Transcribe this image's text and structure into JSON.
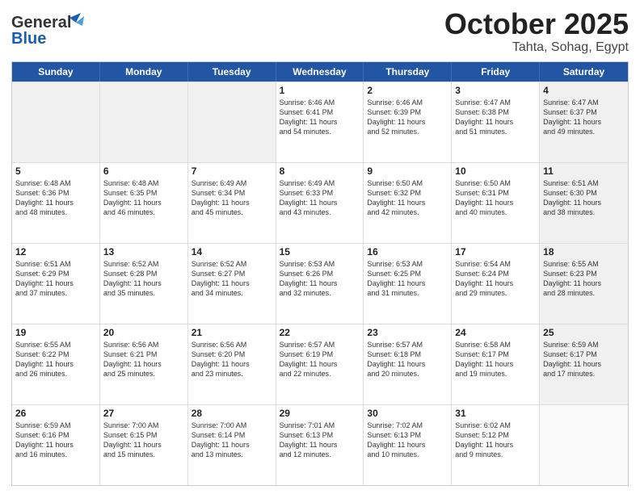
{
  "logo": {
    "line1": "General",
    "line2": "Blue"
  },
  "title": "October 2025",
  "location": "Tahta, Sohag, Egypt",
  "days_of_week": [
    "Sunday",
    "Monday",
    "Tuesday",
    "Wednesday",
    "Thursday",
    "Friday",
    "Saturday"
  ],
  "weeks": [
    [
      {
        "day": "",
        "info": ""
      },
      {
        "day": "",
        "info": ""
      },
      {
        "day": "",
        "info": ""
      },
      {
        "day": "1",
        "info": "Sunrise: 6:46 AM\nSunset: 6:41 PM\nDaylight: 11 hours\nand 54 minutes."
      },
      {
        "day": "2",
        "info": "Sunrise: 6:46 AM\nSunset: 6:39 PM\nDaylight: 11 hours\nand 52 minutes."
      },
      {
        "day": "3",
        "info": "Sunrise: 6:47 AM\nSunset: 6:38 PM\nDaylight: 11 hours\nand 51 minutes."
      },
      {
        "day": "4",
        "info": "Sunrise: 6:47 AM\nSunset: 6:37 PM\nDaylight: 11 hours\nand 49 minutes."
      }
    ],
    [
      {
        "day": "5",
        "info": "Sunrise: 6:48 AM\nSunset: 6:36 PM\nDaylight: 11 hours\nand 48 minutes."
      },
      {
        "day": "6",
        "info": "Sunrise: 6:48 AM\nSunset: 6:35 PM\nDaylight: 11 hours\nand 46 minutes."
      },
      {
        "day": "7",
        "info": "Sunrise: 6:49 AM\nSunset: 6:34 PM\nDaylight: 11 hours\nand 45 minutes."
      },
      {
        "day": "8",
        "info": "Sunrise: 6:49 AM\nSunset: 6:33 PM\nDaylight: 11 hours\nand 43 minutes."
      },
      {
        "day": "9",
        "info": "Sunrise: 6:50 AM\nSunset: 6:32 PM\nDaylight: 11 hours\nand 42 minutes."
      },
      {
        "day": "10",
        "info": "Sunrise: 6:50 AM\nSunset: 6:31 PM\nDaylight: 11 hours\nand 40 minutes."
      },
      {
        "day": "11",
        "info": "Sunrise: 6:51 AM\nSunset: 6:30 PM\nDaylight: 11 hours\nand 38 minutes."
      }
    ],
    [
      {
        "day": "12",
        "info": "Sunrise: 6:51 AM\nSunset: 6:29 PM\nDaylight: 11 hours\nand 37 minutes."
      },
      {
        "day": "13",
        "info": "Sunrise: 6:52 AM\nSunset: 6:28 PM\nDaylight: 11 hours\nand 35 minutes."
      },
      {
        "day": "14",
        "info": "Sunrise: 6:52 AM\nSunset: 6:27 PM\nDaylight: 11 hours\nand 34 minutes."
      },
      {
        "day": "15",
        "info": "Sunrise: 6:53 AM\nSunset: 6:26 PM\nDaylight: 11 hours\nand 32 minutes."
      },
      {
        "day": "16",
        "info": "Sunrise: 6:53 AM\nSunset: 6:25 PM\nDaylight: 11 hours\nand 31 minutes."
      },
      {
        "day": "17",
        "info": "Sunrise: 6:54 AM\nSunset: 6:24 PM\nDaylight: 11 hours\nand 29 minutes."
      },
      {
        "day": "18",
        "info": "Sunrise: 6:55 AM\nSunset: 6:23 PM\nDaylight: 11 hours\nand 28 minutes."
      }
    ],
    [
      {
        "day": "19",
        "info": "Sunrise: 6:55 AM\nSunset: 6:22 PM\nDaylight: 11 hours\nand 26 minutes."
      },
      {
        "day": "20",
        "info": "Sunrise: 6:56 AM\nSunset: 6:21 PM\nDaylight: 11 hours\nand 25 minutes."
      },
      {
        "day": "21",
        "info": "Sunrise: 6:56 AM\nSunset: 6:20 PM\nDaylight: 11 hours\nand 23 minutes."
      },
      {
        "day": "22",
        "info": "Sunrise: 6:57 AM\nSunset: 6:19 PM\nDaylight: 11 hours\nand 22 minutes."
      },
      {
        "day": "23",
        "info": "Sunrise: 6:57 AM\nSunset: 6:18 PM\nDaylight: 11 hours\nand 20 minutes."
      },
      {
        "day": "24",
        "info": "Sunrise: 6:58 AM\nSunset: 6:17 PM\nDaylight: 11 hours\nand 19 minutes."
      },
      {
        "day": "25",
        "info": "Sunrise: 6:59 AM\nSunset: 6:17 PM\nDaylight: 11 hours\nand 17 minutes."
      }
    ],
    [
      {
        "day": "26",
        "info": "Sunrise: 6:59 AM\nSunset: 6:16 PM\nDaylight: 11 hours\nand 16 minutes."
      },
      {
        "day": "27",
        "info": "Sunrise: 7:00 AM\nSunset: 6:15 PM\nDaylight: 11 hours\nand 15 minutes."
      },
      {
        "day": "28",
        "info": "Sunrise: 7:00 AM\nSunset: 6:14 PM\nDaylight: 11 hours\nand 13 minutes."
      },
      {
        "day": "29",
        "info": "Sunrise: 7:01 AM\nSunset: 6:13 PM\nDaylight: 11 hours\nand 12 minutes."
      },
      {
        "day": "30",
        "info": "Sunrise: 7:02 AM\nSunset: 6:13 PM\nDaylight: 11 hours\nand 10 minutes."
      },
      {
        "day": "31",
        "info": "Sunrise: 6:02 AM\nSunset: 5:12 PM\nDaylight: 11 hours\nand 9 minutes."
      },
      {
        "day": "",
        "info": ""
      }
    ]
  ]
}
